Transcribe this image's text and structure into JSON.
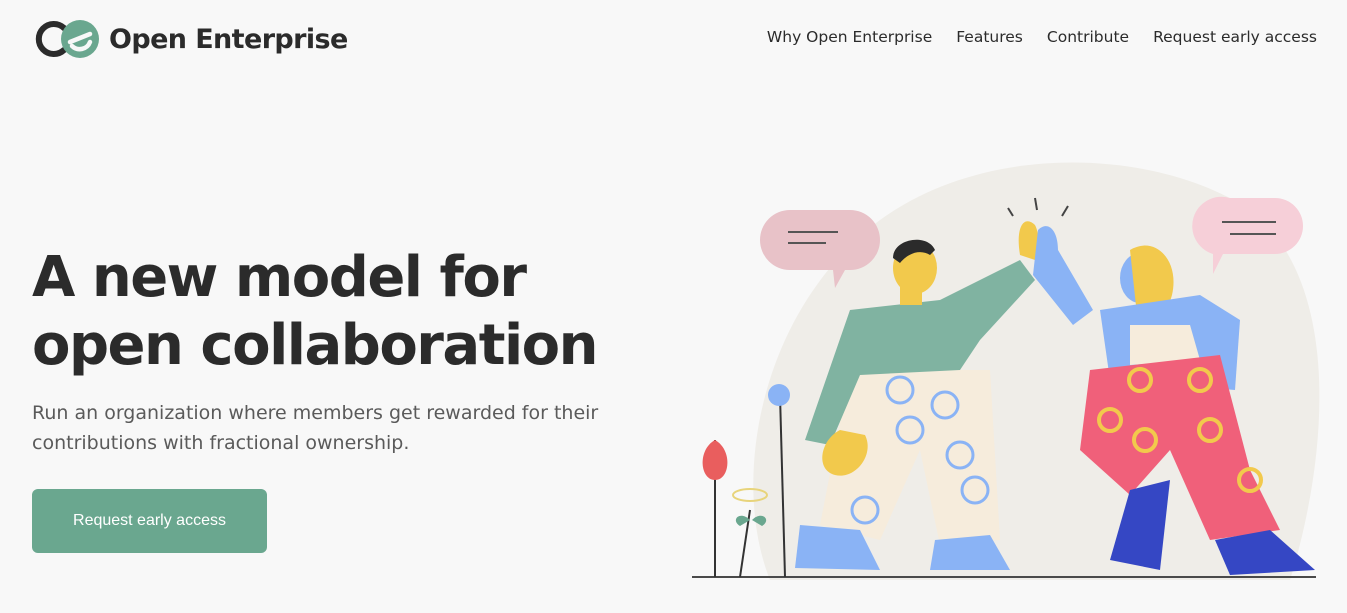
{
  "brand": {
    "name": "Open Enterprise",
    "accent": "#6aa78f",
    "text_color": "#2b2b2b"
  },
  "nav": {
    "items": [
      {
        "label": "Why Open Enterprise"
      },
      {
        "label": "Features"
      },
      {
        "label": "Contribute"
      },
      {
        "label": "Request early access"
      }
    ]
  },
  "hero": {
    "title_line1": "A new model for",
    "title_line2": "open collaboration",
    "subtitle_line1": "Run an organization where members get rewarded for their",
    "subtitle_line2": "contributions with fractional ownership.",
    "cta_label": "Request early access"
  },
  "illustration": {
    "name": "high-five-illustration"
  }
}
